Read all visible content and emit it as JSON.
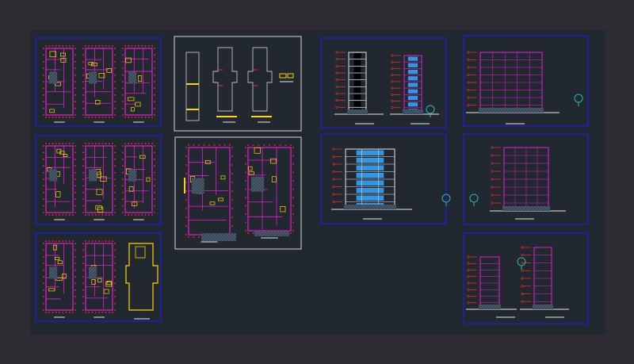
{
  "app": {
    "title": ""
  },
  "canvas": {
    "background": "#212830",
    "outer_background": "#2e2b33"
  },
  "colors": {
    "frame_blue": "#1a1aff",
    "frame_white": "#d8d8d8",
    "wall_magenta": "#e81cd2",
    "wall_red": "#ff2a2a",
    "accent_yellow": "#ffd400",
    "glass_blue": "#35a9ff",
    "tree_cyan": "#2bb7b0",
    "line_white": "#e8e8e8"
  },
  "sheets": [
    {
      "id": "floor-plans-top",
      "kind": "floor-plan-group",
      "count": 3
    },
    {
      "id": "floor-plans-middle",
      "kind": "floor-plan-group",
      "count": 3
    },
    {
      "id": "floor-plans-bottom",
      "kind": "floor-plan-group",
      "count": 3
    },
    {
      "id": "structural-layout",
      "kind": "framing-plan",
      "count": 3
    },
    {
      "id": "plans-pair",
      "kind": "floor-plan-group",
      "count": 2
    },
    {
      "id": "elevations-front",
      "kind": "elevation",
      "count": 2
    },
    {
      "id": "elevation-glass",
      "kind": "elevation",
      "count": 1
    },
    {
      "id": "section-a",
      "kind": "section",
      "count": 1
    },
    {
      "id": "section-b",
      "kind": "section",
      "count": 1
    },
    {
      "id": "sections-narrow",
      "kind": "section",
      "count": 2
    }
  ]
}
